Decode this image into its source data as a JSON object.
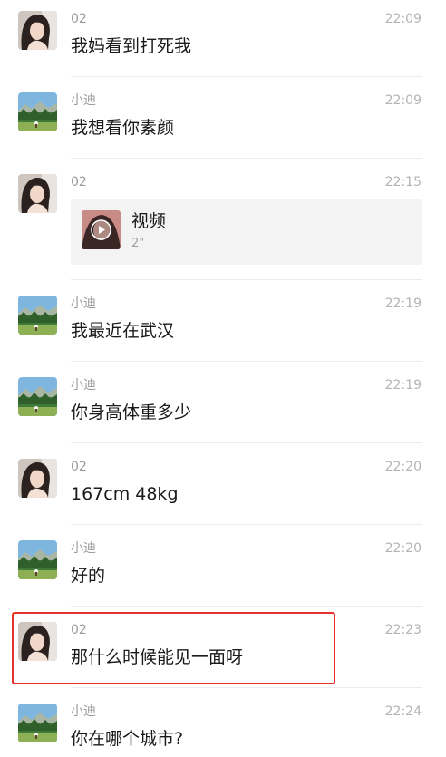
{
  "messages": [
    {
      "sender": "02",
      "time": "22:09",
      "text": "我妈看到打死我",
      "avatar": "girl-avatar"
    },
    {
      "sender": "小迪",
      "time": "22:09",
      "text": "我想看你素颜",
      "avatar": "landscape-avatar"
    },
    {
      "sender": "02",
      "time": "22:15",
      "video": {
        "title": "视频",
        "duration": "2\""
      },
      "avatar": "girl-avatar"
    },
    {
      "sender": "小迪",
      "time": "22:19",
      "text": "我最近在武汉",
      "avatar": "landscape-avatar"
    },
    {
      "sender": "小迪",
      "time": "22:19",
      "text": "你身高体重多少",
      "avatar": "landscape-avatar"
    },
    {
      "sender": "02",
      "time": "22:20",
      "text": "167cm 48kg",
      "avatar": "girl-avatar"
    },
    {
      "sender": "小迪",
      "time": "22:20",
      "text": "好的",
      "avatar": "landscape-avatar"
    },
    {
      "sender": "02",
      "time": "22:23",
      "text": "那什么时候能见一面呀",
      "avatar": "girl-avatar",
      "highlighted": true
    },
    {
      "sender": "小迪",
      "time": "22:24",
      "text": "你在哪个城市?",
      "avatar": "landscape-avatar"
    }
  ],
  "colors": {
    "highlight_border": "#e5312d",
    "timestamp": "#b4b4b4",
    "sender": "#9a9a9a"
  }
}
